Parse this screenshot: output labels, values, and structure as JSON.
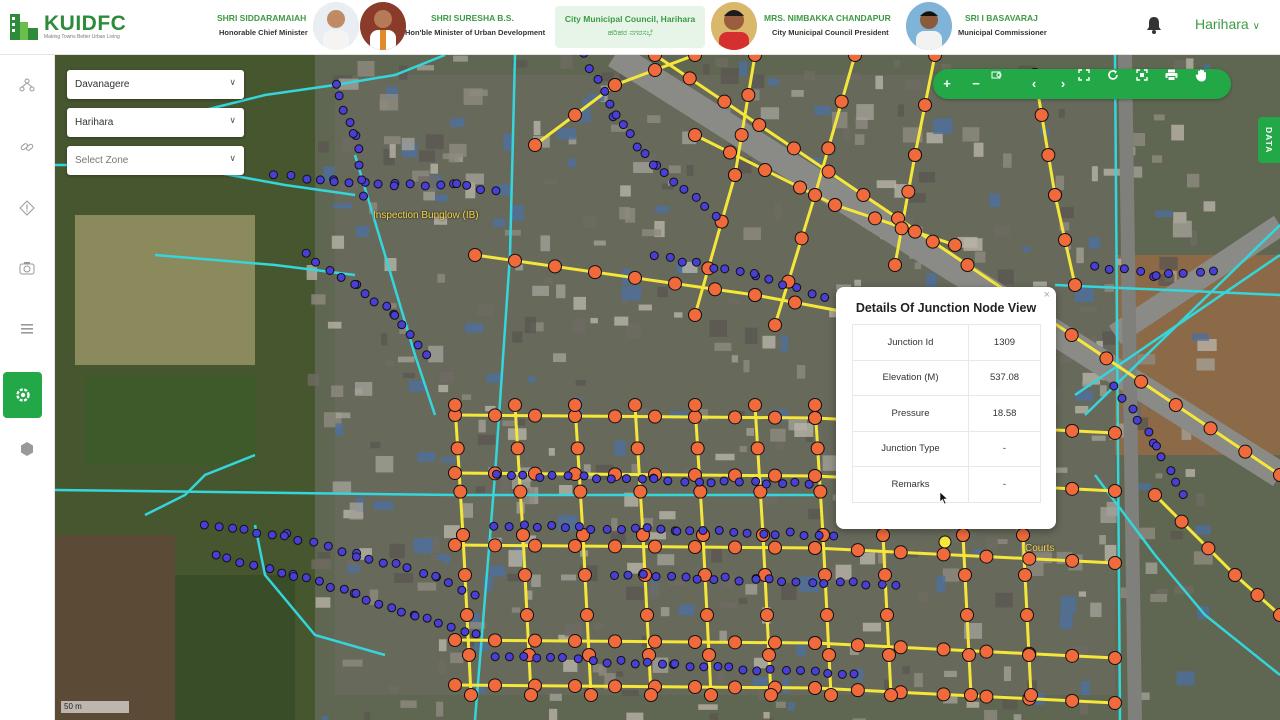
{
  "header": {
    "logo_text": "KUIDFC",
    "logo_tagline": "Making Towns Better Urban Living",
    "dignitaries": [
      {
        "name": "SHRI SIDDARAMAIAH",
        "role": "Honorable Chief Minister"
      },
      {
        "name": "SHRI SURESHA B.S.",
        "role": "Hon'ble Minister of Urban Development"
      },
      {
        "name": "MRS. NIMBAKKA CHANDAPUR",
        "role": "City Municipal Council President"
      },
      {
        "name": "SRI I BASAVARAJ",
        "role": "Municipal Commissioner"
      }
    ],
    "city_box": {
      "english": "City Municipal Council, Harihara",
      "kannada": "ಹರಿಹರ ನಗರಸಭೆ"
    },
    "city_selector": "Harihara"
  },
  "filters": {
    "district": "Davanagere",
    "city": "Harihara",
    "zone_placeholder": "Select Zone"
  },
  "data_tab": "DATA",
  "map_labels": {
    "place_1": "Inspection Bunglow (IB)",
    "place_2": "Courts"
  },
  "scale_label": "50 m",
  "popup": {
    "title": "Details Of Junction Node View",
    "close": "×",
    "rows": [
      {
        "label": "Junction Id",
        "value": "1309"
      },
      {
        "label": "Elevation (M)",
        "value": "537.08"
      },
      {
        "label": "Pressure",
        "value": "18.58"
      },
      {
        "label": "Junction Type",
        "value": "-"
      },
      {
        "label": "Remarks",
        "value": "-"
      }
    ]
  },
  "toolbar_icons": [
    "zoom-in",
    "zoom-out",
    "zoom-box",
    "previous-extent",
    "next-extent",
    "full-extent",
    "refresh",
    "fullscreen",
    "print",
    "pan"
  ],
  "colors": {
    "brand_green": "#22a846",
    "pipe_yellow": "#f5e63a",
    "pipe_cyan": "#34d6dc",
    "junction_orange": "#f06a3c",
    "node_blue": "#4a3fd4"
  }
}
